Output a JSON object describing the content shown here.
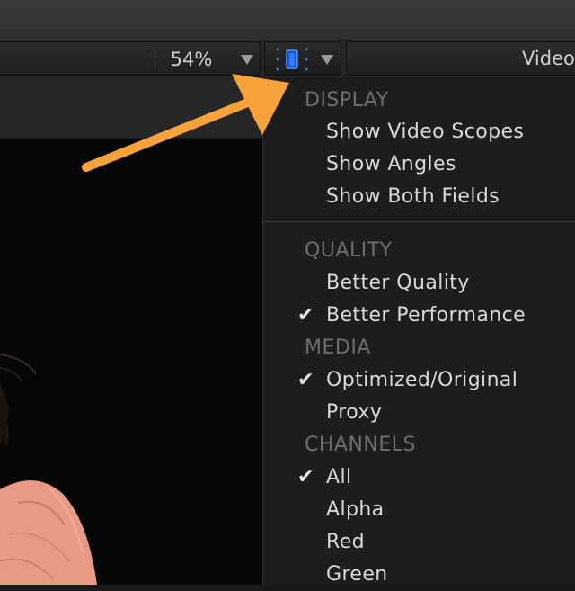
{
  "toolbar": {
    "zoom_value": "54%",
    "video_label": "Video"
  },
  "menu": {
    "sections": {
      "display": {
        "header": "DISPLAY",
        "items": [
          {
            "label": "Show Video Scopes",
            "checked": false
          },
          {
            "label": "Show Angles",
            "checked": false
          },
          {
            "label": "Show Both Fields",
            "checked": false
          }
        ]
      },
      "quality": {
        "header": "QUALITY",
        "items": [
          {
            "label": "Better Quality",
            "checked": false
          },
          {
            "label": "Better Performance",
            "checked": true
          }
        ]
      },
      "media": {
        "header": "MEDIA",
        "items": [
          {
            "label": "Optimized/Original",
            "checked": true
          },
          {
            "label": "Proxy",
            "checked": false
          }
        ]
      },
      "channels": {
        "header": "CHANNELS",
        "items": [
          {
            "label": "All",
            "checked": true
          },
          {
            "label": "Alpha",
            "checked": false
          },
          {
            "label": "Red",
            "checked": false
          },
          {
            "label": "Green",
            "checked": false
          }
        ]
      }
    },
    "check_glyph": "✔"
  },
  "colors": {
    "annotation_arrow": "#f7a23a",
    "view_icon_blue": "#2b7bff",
    "menu_background": "#1d1d1d",
    "header_text": "#6e6e6e",
    "item_text": "#d9d9d9"
  },
  "icons": {
    "view_options": "viewer-display-icon",
    "dropdown": "triangle-down-icon"
  }
}
